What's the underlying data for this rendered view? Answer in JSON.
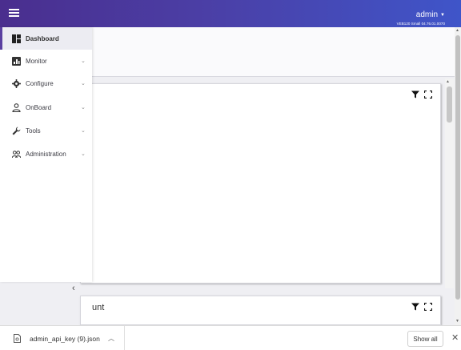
{
  "header": {
    "user_name": "admin",
    "version": "VEB120 Small 04.76.01.0070"
  },
  "sidebar": {
    "items": [
      {
        "label": "Dashboard",
        "icon": "dashboard-icon",
        "active": true
      },
      {
        "label": "Monitor",
        "icon": "monitor-icon"
      },
      {
        "label": "Configure",
        "icon": "gear-icon"
      },
      {
        "label": "OnBoard",
        "icon": "onboard-icon"
      },
      {
        "label": "Tools",
        "icon": "wrench-icon"
      },
      {
        "label": "Administration",
        "icon": "users-icon"
      }
    ],
    "collapse_glyph": "‹"
  },
  "cards": [
    {
      "title": ""
    },
    {
      "title": "unt"
    }
  ],
  "download_bar": {
    "file_name": "admin_api_key (9).json",
    "show_all_label": "Show all"
  },
  "colors": {
    "accent": "#5a3fa0",
    "topbar_start": "#4a2e8e",
    "topbar_end": "#3f55c9"
  }
}
